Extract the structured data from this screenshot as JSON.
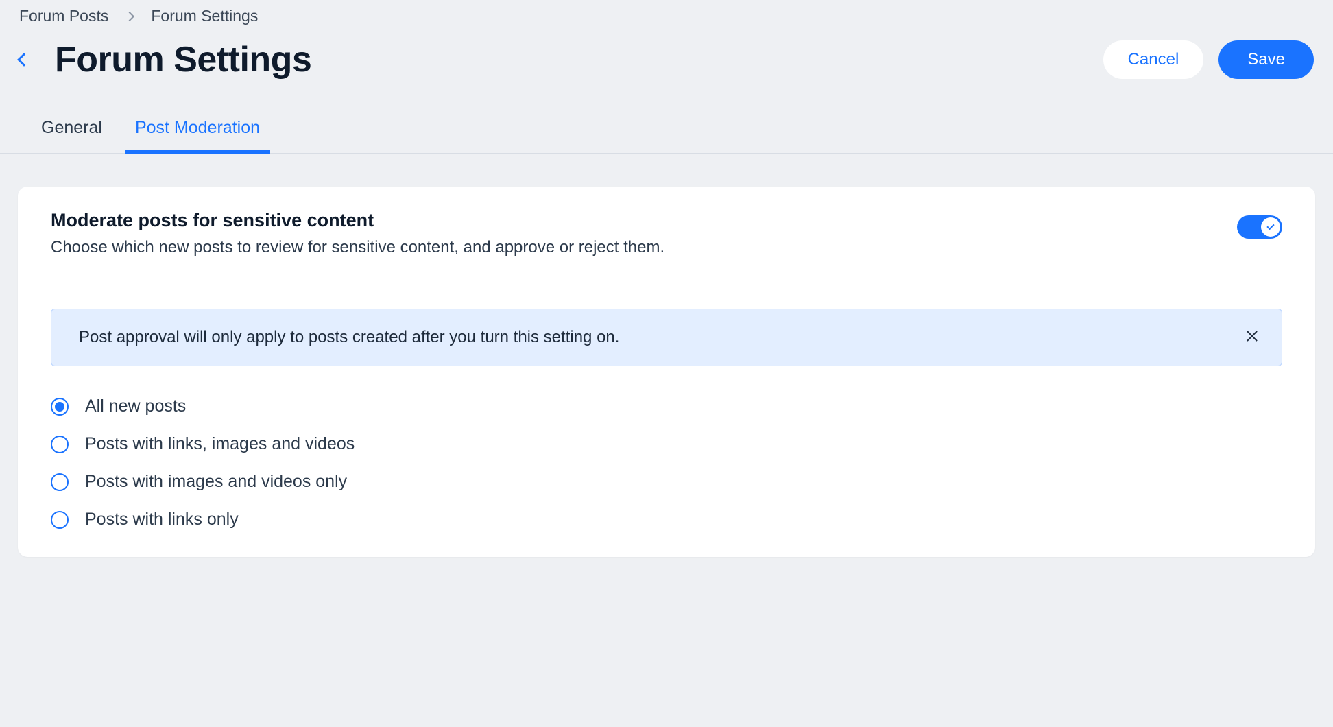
{
  "breadcrumb": {
    "items": [
      "Forum Posts",
      "Forum Settings"
    ]
  },
  "header": {
    "title": "Forum Settings",
    "cancel_label": "Cancel",
    "save_label": "Save"
  },
  "tabs": [
    {
      "label": "General",
      "active": false
    },
    {
      "label": "Post Moderation",
      "active": true
    }
  ],
  "card": {
    "title": "Moderate posts for sensitive content",
    "description": "Choose which new posts to review for sensitive content, and approve or reject them.",
    "toggle_on": true,
    "banner_text": "Post approval will only apply to posts created after you turn this setting on.",
    "options": [
      {
        "label": "All new posts",
        "selected": true
      },
      {
        "label": "Posts with links, images and videos",
        "selected": false
      },
      {
        "label": "Posts with images and videos only",
        "selected": false
      },
      {
        "label": "Posts with links only",
        "selected": false
      }
    ]
  },
  "colors": {
    "accent": "#1a73ff",
    "page_bg": "#eef0f3",
    "banner_bg": "#e3eeff"
  }
}
